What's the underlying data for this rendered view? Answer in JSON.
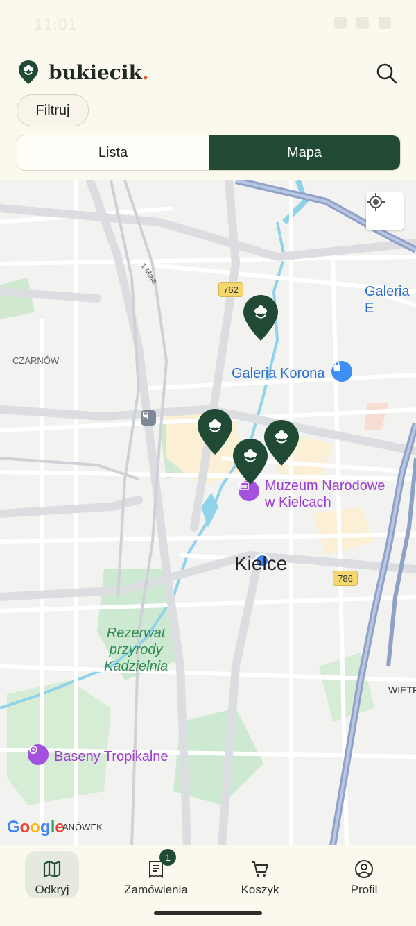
{
  "status": {
    "time": "11:01"
  },
  "header": {
    "app_name": "bukiecik",
    "brand_dot": ".",
    "filter_label": "Filtruj"
  },
  "tabs": {
    "list_label": "Lista",
    "map_label": "Mapa",
    "active": "Mapa"
  },
  "map": {
    "labels": {
      "district_czarnow": "CZARNÓW",
      "street_1maja": "1 Maja",
      "galeria_b": "Galeria E",
      "galeria_korona": "Galeria Korona",
      "muzeum_line1": "Muzeum Narodowe",
      "muzeum_line2": "w Kielcach",
      "city": "Kielce",
      "rezerwat_line1": "Rezerwat",
      "rezerwat_line2": "przyrody",
      "rezerwat_line3": "Kadzielnia",
      "wietrznia": "WIETR",
      "baseny": "Baseny Tropikalne",
      "anowek": "ANÓWEK",
      "road_762": "762",
      "road_786": "786"
    },
    "google": {
      "G": "G",
      "o1": "o",
      "o2": "o",
      "g": "g",
      "l": "l",
      "e": "e"
    }
  },
  "bottom_nav": {
    "items": [
      {
        "label": "Odkryj",
        "icon": "map-icon",
        "active": true
      },
      {
        "label": "Zamówienia",
        "icon": "receipt-icon",
        "badge": "1"
      },
      {
        "label": "Koszyk",
        "icon": "cart-icon"
      },
      {
        "label": "Profil",
        "icon": "profile-icon"
      }
    ]
  },
  "colors": {
    "primary": "#214a35",
    "accent": "#d5662b",
    "background": "#fbf8ee"
  }
}
